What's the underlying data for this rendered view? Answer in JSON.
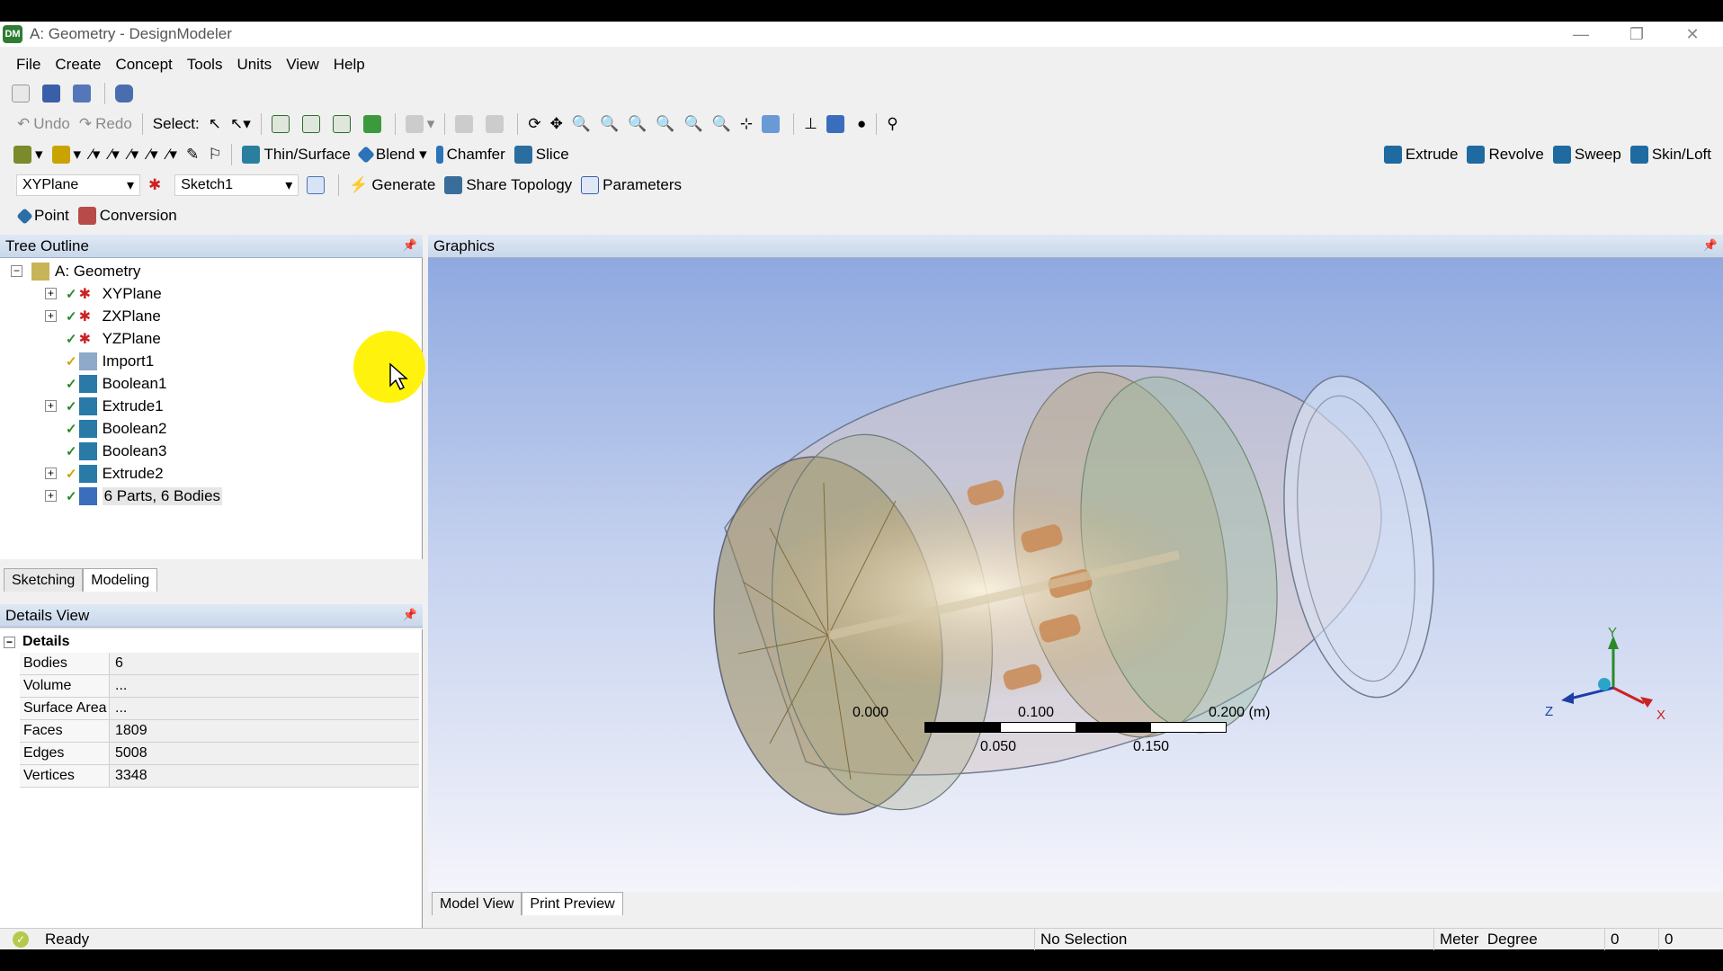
{
  "window": {
    "title": "A: Geometry - DesignModeler"
  },
  "menu": [
    "File",
    "Create",
    "Concept",
    "Tools",
    "Units",
    "View",
    "Help"
  ],
  "toolbar2": {
    "undo": "Undo",
    "redo": "Redo",
    "select": "Select:"
  },
  "toolbar3": {
    "thin": "Thin/Surface",
    "blend": "Blend",
    "chamfer": "Chamfer",
    "slice": "Slice",
    "extrude": "Extrude",
    "revolve": "Revolve",
    "sweep": "Sweep",
    "skinloft": "Skin/Loft"
  },
  "toolbar4": {
    "plane": "XYPlane",
    "sketch": "Sketch1",
    "generate": "Generate",
    "share": "Share Topology",
    "params": "Parameters"
  },
  "toolbar5": {
    "point": "Point",
    "conversion": "Conversion"
  },
  "tree": {
    "header": "Tree Outline",
    "root": "A: Geometry",
    "items": [
      "XYPlane",
      "ZXPlane",
      "YZPlane",
      "Import1",
      "Boolean1",
      "Extrude1",
      "Boolean2",
      "Boolean3",
      "Extrude2",
      "6 Parts, 6 Bodies"
    ]
  },
  "tabs": {
    "sketching": "Sketching",
    "modeling": "Modeling"
  },
  "details": {
    "header": "Details View",
    "group": "Details",
    "rows": [
      {
        "k": "Bodies",
        "v": "6"
      },
      {
        "k": "Volume",
        "v": "..."
      },
      {
        "k": "Surface Area",
        "v": "..."
      },
      {
        "k": "Faces",
        "v": "1809"
      },
      {
        "k": "Edges",
        "v": "5008"
      },
      {
        "k": "Vertices",
        "v": "3348"
      }
    ]
  },
  "graphics": {
    "header": "Graphics",
    "scale_top": [
      "0.000",
      "0.100",
      "0.200 (m)"
    ],
    "scale_bottom": [
      "0.050",
      "0.150"
    ],
    "axes": {
      "x": "X",
      "y": "Y",
      "z": "Z"
    },
    "tab_model": "Model View",
    "tab_print": "Print Preview"
  },
  "status": {
    "ready": "Ready",
    "selection": "No Selection",
    "units": "Meter  Degree",
    "v1": "0",
    "v2": "0"
  }
}
